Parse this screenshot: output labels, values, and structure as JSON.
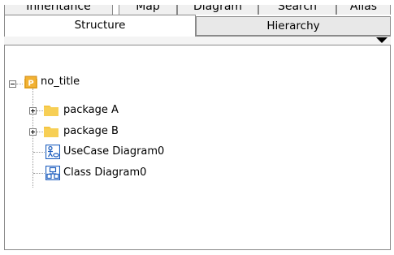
{
  "tabs_top": [
    "Inheritance",
    "Map",
    "Diagram",
    "Search",
    "Alias"
  ],
  "tabs_main": {
    "active": "Structure",
    "inactive": "Hierarchy"
  },
  "tree": {
    "root": "no_title",
    "root_icon": "package-root-icon",
    "children": [
      {
        "label": "package A",
        "icon": "folder-icon",
        "expandable": true
      },
      {
        "label": "package B",
        "icon": "folder-icon",
        "expandable": true
      },
      {
        "label": "UseCase Diagram0",
        "icon": "usecase-diagram-icon",
        "expandable": false
      },
      {
        "label": "Class Diagram0",
        "icon": "class-diagram-icon",
        "expandable": false
      }
    ]
  },
  "colors": {
    "folder": "#f5c542",
    "root_badge": "#f2b233",
    "diagram_blue": "#1f5fbf"
  }
}
